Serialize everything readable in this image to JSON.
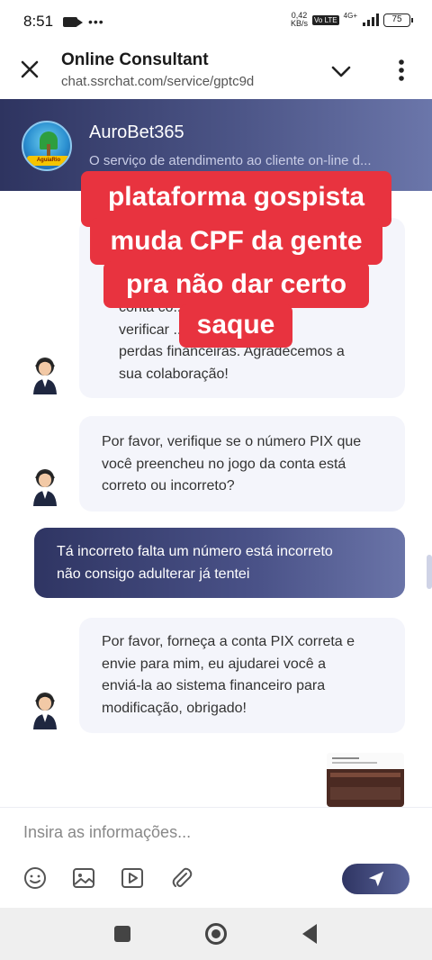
{
  "status_bar": {
    "time": "8:51",
    "net_speed_value": "0,42",
    "net_speed_unit": "KB/s",
    "volte": "Vo LTE",
    "network": "4G+",
    "battery": "75"
  },
  "app_bar": {
    "title": "Online Consultant",
    "url": "chat.ssrchat.com/service/gptc9d"
  },
  "chat_header": {
    "brand_name": "AuroBet365",
    "brand_subtitle": "O serviço de atendimento ao cliente on-line d...",
    "logo_text": "AguiaRio"
  },
  "messages": [
    {
      "side": "in",
      "lines": [
        "conta co... e-se de",
        "verificar ... a evitar",
        "perdas financeiras. Agradecemos a",
        "sua colaboração!"
      ]
    },
    {
      "side": "in",
      "lines": [
        "Por favor, verifique se o número PIX que",
        "você preencheu no jogo da conta está",
        "correto ou incorreto?"
      ]
    },
    {
      "side": "out",
      "lines": [
        "Tá incorreto falta um número está incorreto",
        "não consigo adulterar já tentei"
      ]
    },
    {
      "side": "in",
      "lines": [
        "Por favor, forneça a conta PIX correta e",
        "envie para mim, eu ajudarei você a",
        "enviá-la ao sistema financeiro para",
        "modificação, obrigado!"
      ]
    }
  ],
  "caption": {
    "lines": [
      "plataforma gospista",
      "muda CPF da gente",
      "pra não dar certo",
      "saque"
    ]
  },
  "input": {
    "placeholder": "Insira as informações..."
  },
  "toolbar": {
    "icons": [
      "emoji-icon",
      "image-icon",
      "video-icon",
      "attachment-icon"
    ],
    "send_icon": "send-icon"
  },
  "colors": {
    "accent_dark": "#2f3563",
    "accent_light": "#6a74a8",
    "caption_red": "#e8333f",
    "bubble_in": "#f4f5fb"
  }
}
